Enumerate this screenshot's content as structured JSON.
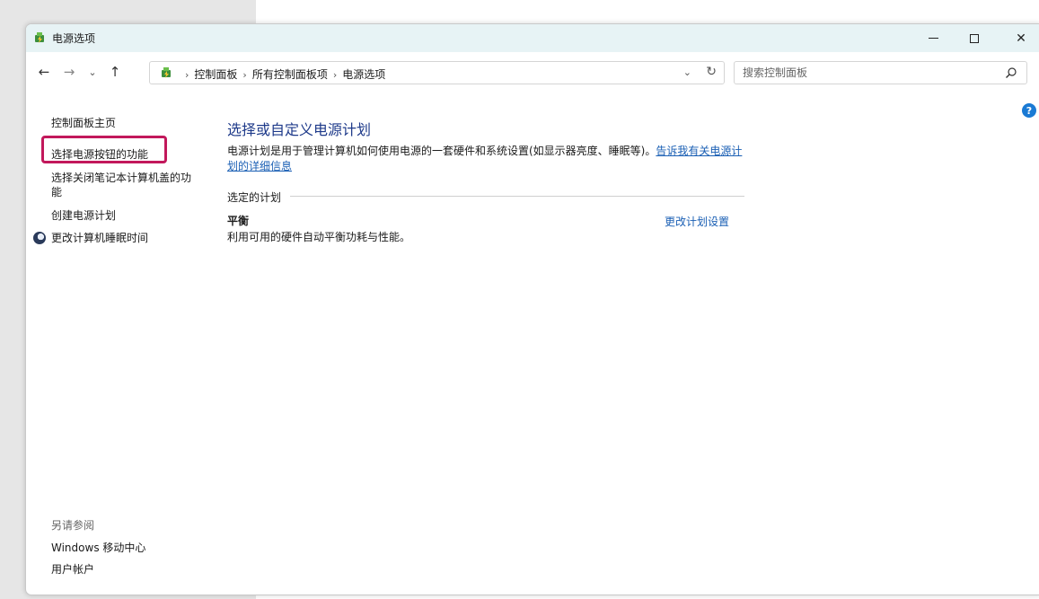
{
  "window": {
    "title": "电源选项",
    "minimize_label": "—",
    "close_label": "✕"
  },
  "nav": {
    "back_glyph": "←",
    "forward_glyph": "→",
    "recent_glyph": "⌄",
    "up_glyph": "↑"
  },
  "address": {
    "crumbs": [
      "控制面板",
      "所有控制面板项",
      "电源选项"
    ],
    "separator": "›",
    "dropdown_glyph": "⌄",
    "refresh_glyph": "↻"
  },
  "search": {
    "placeholder": "搜索控制面板"
  },
  "help": {
    "glyph": "?"
  },
  "sidebar": {
    "home": "控制面板主页",
    "power_buttons": "选择电源按钮的功能",
    "lid": "选择关闭笔记本计算机盖的功能",
    "create_plan": "创建电源计划",
    "sleep": "更改计算机睡眠时间",
    "see_also": "另请参阅",
    "mobility": "Windows 移动中心",
    "accounts": "用户帐户"
  },
  "main": {
    "title": "选择或自定义电源计划",
    "description": "电源计划是用于管理计算机如何使用电源的一套硬件和系统设置(如显示器亮度、睡眠等)。",
    "description_link": "告诉我有关电源计划的详细信息",
    "selected_plan_label": "选定的计划",
    "plan_name": "平衡",
    "plan_description": "利用可用的硬件自动平衡功耗与性能。",
    "change_plan_link": "更改计划设置"
  },
  "colors": {
    "highlight": "#c2185b",
    "link": "#1a5fb4",
    "title": "#1e3a8a",
    "titlebar": "#e7f3f5"
  }
}
